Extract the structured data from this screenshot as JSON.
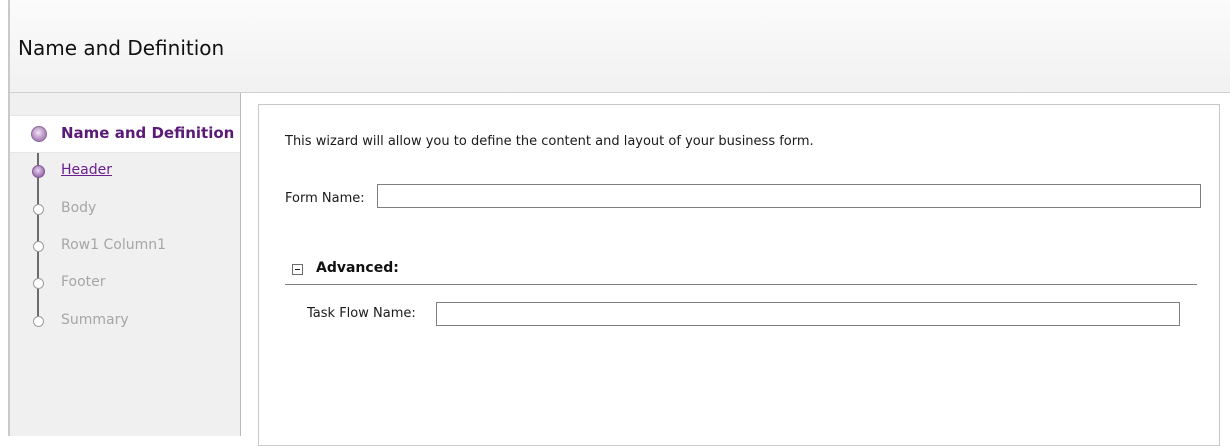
{
  "header": {
    "title": "Name and Definition"
  },
  "train": {
    "steps": [
      {
        "label": "Name and Definition",
        "state": "selected"
      },
      {
        "label": "Header",
        "state": "visited"
      },
      {
        "label": "Body",
        "state": "disabled"
      },
      {
        "label": "Row1 Column1",
        "state": "disabled"
      },
      {
        "label": "Footer",
        "state": "disabled"
      },
      {
        "label": "Summary",
        "state": "disabled"
      }
    ]
  },
  "main": {
    "intro": "This wizard will allow you to define the content and layout of your business form.",
    "form_name": {
      "label": "Form Name:",
      "value": ""
    },
    "advanced": {
      "title": "Advanced:",
      "task_flow_name": {
        "label": "Task Flow Name:",
        "value": ""
      }
    }
  }
}
